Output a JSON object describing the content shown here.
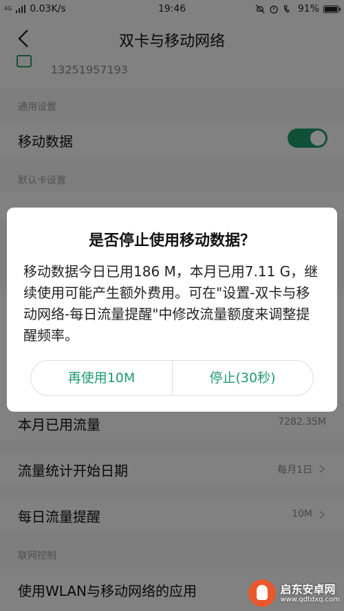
{
  "status": {
    "network_speed": "0.03K/s",
    "time": "19:46",
    "battery": "91%",
    "battery_level": 0.91,
    "net_label": "4G"
  },
  "header": {
    "title": "双卡与移动网络"
  },
  "sim": {
    "number": "13251957193"
  },
  "sections": {
    "general": "通用设置",
    "default_card": "默认卡设置",
    "network_control": "联网控制"
  },
  "rows": {
    "mobile_data": {
      "label": "移动数据",
      "on": true
    },
    "month_used": {
      "label": "本月已用流量",
      "value": "7282.35M"
    },
    "stat_start": {
      "label": "流量统计开始日期",
      "value": "每月1日"
    },
    "daily_reminder": {
      "label": "每日流量提醒",
      "value": "10M"
    },
    "wlan_apps": {
      "label": "使用WLAN与移动网络的应用"
    }
  },
  "dialog": {
    "title": "是否停止使用移动数据？",
    "message": "移动数据今日已用186 M，本月已用7.11 G，继续使用可能产生额外费用。可在\"设置-双卡与移动网络-每日流量提醒\"中修改流量额度来调整提醒频率。",
    "continue_button": "再使用10M",
    "stop_button": "停止(30秒)"
  },
  "watermark": {
    "name": "启东安卓网",
    "url": "www.qdtdxq.com"
  },
  "colors": {
    "accent": "#1e9a6e"
  }
}
